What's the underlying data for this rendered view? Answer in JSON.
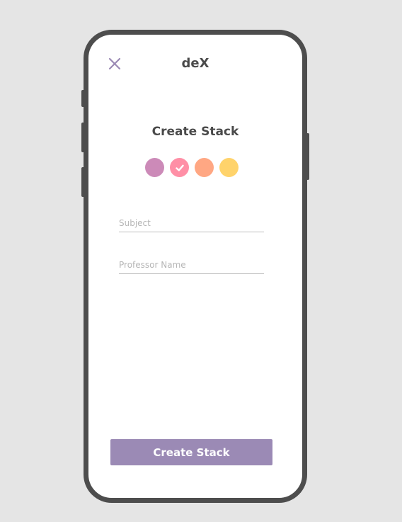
{
  "header": {
    "app_title": "deX",
    "close_icon": "close-icon"
  },
  "main": {
    "title": "Create Stack",
    "colors": [
      {
        "name": "purple",
        "hex": "#cc8ab8",
        "selected": false
      },
      {
        "name": "pink",
        "hex": "#ff8fa6",
        "selected": true
      },
      {
        "name": "peach",
        "hex": "#ffa783",
        "selected": false
      },
      {
        "name": "yellow",
        "hex": "#ffd36b",
        "selected": false
      }
    ],
    "subject_field": {
      "placeholder": "Subject",
      "value": ""
    },
    "professor_field": {
      "placeholder": "Professor Name",
      "value": ""
    }
  },
  "footer": {
    "submit_label": "Create Stack"
  },
  "theme": {
    "accent": "#9b8ab5",
    "device_frame": "#4d4d4d",
    "background": "#e5e5e5"
  }
}
